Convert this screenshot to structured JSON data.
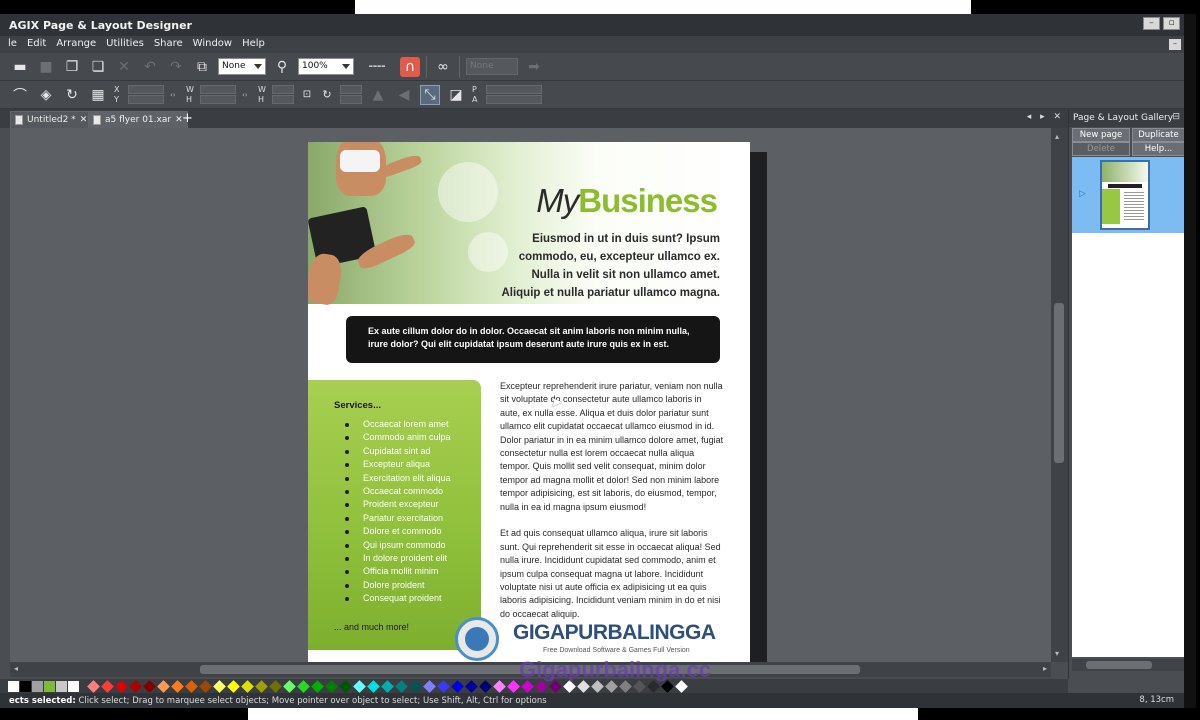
{
  "app": {
    "title": "AGIX Page & Layout Designer",
    "window_buttons": [
      "–",
      "▫"
    ],
    "mdi_button": "–"
  },
  "menu": [
    "le",
    "Edit",
    "Arrange",
    "Utilities",
    "Share",
    "Window",
    "Help"
  ],
  "toolbar1": {
    "fill_combo": "None",
    "zoom_combo": "100%",
    "disabled_combo": "None"
  },
  "toolbar2": {
    "x_label": "X",
    "y_label": "Y",
    "w_label": "W",
    "h_label": "H",
    "w2_label": "W",
    "h2_label": "H",
    "p_label": "P",
    "a_label": "A",
    "pct": "%"
  },
  "tabs": [
    {
      "label": "Untitled2 *",
      "close": "✕"
    },
    {
      "label": "a5 flyer 01.xar",
      "close": "✕"
    }
  ],
  "tab_add": "+",
  "tab_nav": "◂ ▸ ✕",
  "document": {
    "logo_my": "My",
    "logo_business": "Business",
    "tagline": "Eiusmod in ut in duis sunt? Ipsum commodo, eu, excepteur ullamco ex. Nulla in velit sit non ullamco amet. Aliquip et nulla pariatur ullamco magna.",
    "callout": "Ex aute cillum dolor do in dolor. Occaecat sit anim laboris non minim nulla, irure dolor? Qui elit cupidatat ipsum deserunt aute irure quis ex in est.",
    "services_title": "Services...",
    "services": [
      "Occaecat lorem amet",
      "Commodo anim culpa",
      "Cupidatat sint ad",
      "Excepteur aliqua",
      "Exercitation elit aliqua",
      "Occaecat commodo",
      "Proident excepteur",
      "Pariatur exercitation",
      "Dolore et commodo",
      "Qui ipsum commodo",
      "In dolore proident elit",
      "Officia mollit minim",
      "Dolore proident",
      "Consequat proident"
    ],
    "services_more": "... and much more!",
    "paragraph1": "Excepteur reprehenderit irure pariatur, veniam non nulla sit voluptate do consectetur aute ullamco laboris in aute, ex nulla esse. Aliqua et duis dolor pariatur sunt ullamco elit cupidatat occaecat ullamco eiusmod in id. Dolor pariatur in in ea minim ullamco dolore amet, fugiat consectetur nulla est lorem occaecat nulla aliqua tempor. Quis mollit sed velit consequat, minim dolor tempor ad magna mollit et dolor! Sed non minim labore tempor adipisicing, est sit laboris, do eiusmod, tempor, nulla in ea id magna ipsum eiusmod!",
    "paragraph2": "Et ad quis consequat ullamco aliqua, irure sit laboris sunt. Qui reprehenderit sit esse in occaecat aliqua! Sed nulla irure. Incididunt cupidatat sed commodo, anim et ipsum culpa consequat magna ut labore. Incididunt voluptate nisi ut aute officia ex adipisicing ut ea quis laboris adipisicing. Incididunt veniam minim in do et nisi do occaecat aliquip."
  },
  "watermark": {
    "name": "GIGAPURBALINGGA",
    "sub": "Free Download Software & Games Full Version",
    "url": "Gigapurbalinga.cc"
  },
  "gallery": {
    "title": "Page & Layout Gallery",
    "pin": "⊟",
    "new_page": "New page",
    "duplicate": "Duplicate",
    "delete": "Delete",
    "help": "Help...",
    "thumb_arrow": "▷"
  },
  "colors": {
    "swatches": [
      "#ffffff",
      "#000000",
      "#a0a0a0",
      "#7fb83c",
      "#c8c8c8",
      "#ffffff"
    ],
    "diamonds": [
      "#ff7f7f",
      "#ff3b3b",
      "#e00000",
      "#b00000",
      "#800000",
      "#ff9a55",
      "#ff7a1a",
      "#e06000",
      "#a04800",
      "#ffff66",
      "#ffff00",
      "#e0e000",
      "#a0a000",
      "#707000",
      "#66ff66",
      "#22dd22",
      "#00b000",
      "#008000",
      "#005500",
      "#66ffff",
      "#00e0e0",
      "#00b0b0",
      "#008080",
      "#005555",
      "#8080ff",
      "#3a3aff",
      "#0000e0",
      "#0000a0",
      "#000070",
      "#ff80ff",
      "#ff33ff",
      "#d000d0",
      "#a000a0",
      "#700070",
      "#ffffff",
      "#e0e0e0",
      "#c0c0c0",
      "#a0a0a0",
      "#808080",
      "#555555",
      "#2a2a2a",
      "#000000",
      "#ffffff"
    ]
  },
  "status": {
    "bold": "ects selected:",
    "text": " Click select; Drag to marquee select objects; Move pointer over object to select; Use Shift, Alt, Ctrl for options",
    "right": "8, 13cm"
  },
  "scroll": {
    "left": "◂",
    "right": "▸",
    "up": "▴",
    "down": "▾"
  }
}
